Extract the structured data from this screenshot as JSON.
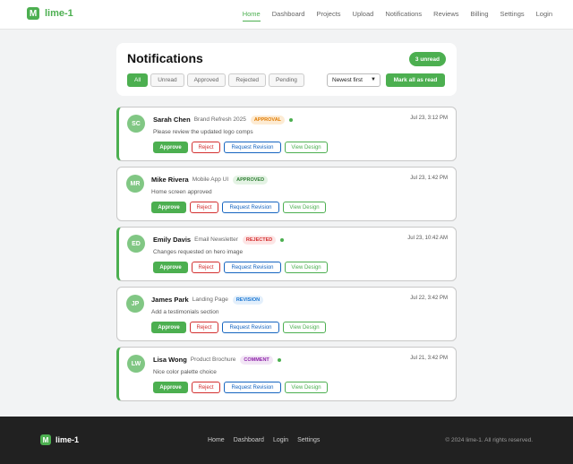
{
  "brand": {
    "logo_letter": "M",
    "name": "lime-1"
  },
  "nav": [
    "Home",
    "Dashboard",
    "Projects",
    "Upload",
    "Notifications",
    "Reviews",
    "Billing",
    "Settings",
    "Login"
  ],
  "page": {
    "title": "Notifications",
    "unread_badge": "3 unread",
    "filters": [
      "All",
      "Unread",
      "Approved",
      "Rejected",
      "Pending"
    ],
    "sort_value": "Newest first",
    "mark_all_label": "Mark all as read"
  },
  "actions": {
    "approve": "Approve",
    "reject": "Reject",
    "revision": "Request Revision",
    "view": "View Design"
  },
  "notifications": [
    {
      "initials": "SC",
      "name": "Sarah Chen",
      "project": "Brand Refresh 2025",
      "tag": "APPROVAL",
      "message": "Please review the updated logo comps",
      "time": "Jul 23, 3:12 PM",
      "unread": true
    },
    {
      "initials": "MR",
      "name": "Mike Rivera",
      "project": "Mobile App UI",
      "tag": "APPROVED",
      "message": "Home screen approved",
      "time": "Jul 23, 1:42 PM",
      "unread": false
    },
    {
      "initials": "ED",
      "name": "Emily Davis",
      "project": "Email Newsletter",
      "tag": "REJECTED",
      "message": "Changes requested on hero image",
      "time": "Jul 23, 10:42 AM",
      "unread": true
    },
    {
      "initials": "JP",
      "name": "James Park",
      "project": "Landing Page",
      "tag": "REVISION",
      "message": "Add a testimonials section",
      "time": "Jul 22, 3:42 PM",
      "unread": false
    },
    {
      "initials": "LW",
      "name": "Lisa Wong",
      "project": "Product Brochure",
      "tag": "COMMENT",
      "message": "Nice color palette choice",
      "time": "Jul 21, 3:42 PM",
      "unread": true
    }
  ],
  "footer": {
    "brand": "lime-1",
    "links": [
      "Home",
      "Dashboard",
      "Login",
      "Settings"
    ],
    "copyright": "© 2024 lime-1. All rights reserved."
  },
  "colors": {
    "accent": "#4caf50",
    "footer_bg": "#212121"
  }
}
